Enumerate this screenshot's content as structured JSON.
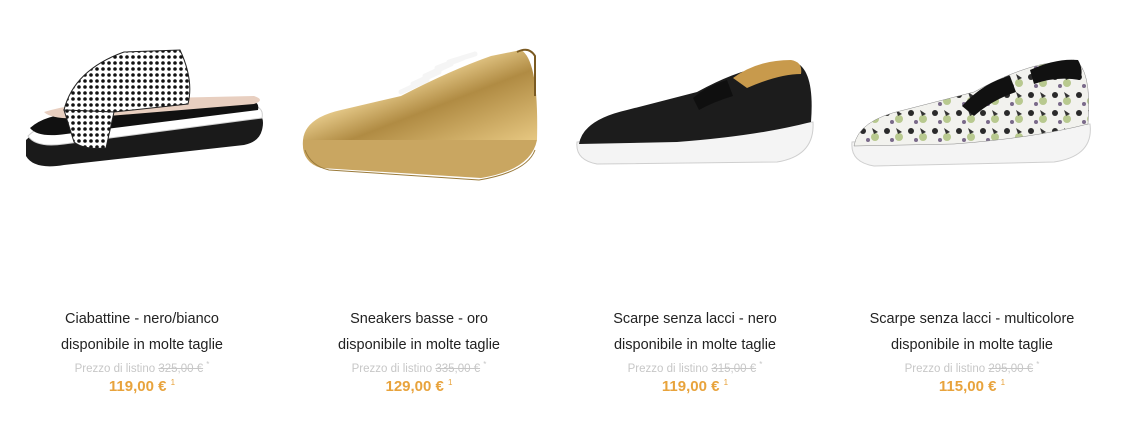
{
  "products": [
    {
      "name": "Ciabattine - nero/bianco",
      "availability": "disponibile in molte taglie",
      "list_label": "Prezzo di listino",
      "list_price": "325,00 €",
      "list_mark": "*",
      "price": "119,00 €",
      "price_mark": "1",
      "image_icon": "sandal-icon"
    },
    {
      "name": "Sneakers basse - oro",
      "availability": "disponibile in molte taglie",
      "list_label": "Prezzo di listino",
      "list_price": "335,00 €",
      "list_mark": "*",
      "price": "129,00 €",
      "price_mark": "1",
      "image_icon": "sneaker-icon"
    },
    {
      "name": "Scarpe senza lacci - nero",
      "availability": "disponibile in molte taglie",
      "list_label": "Prezzo di listino",
      "list_price": "315,00 €",
      "list_mark": "*",
      "price": "119,00 €",
      "price_mark": "1",
      "image_icon": "slip-on-icon"
    },
    {
      "name": "Scarpe senza lacci - multicolore",
      "availability": "disponibile in molte taglie",
      "list_label": "Prezzo di listino",
      "list_price": "295,00 €",
      "list_mark": "*",
      "price": "115,00 €",
      "price_mark": "1",
      "image_icon": "slip-on-icon"
    }
  ],
  "colors": {
    "price": "#e8a33c",
    "list_price": "#c7c7c7",
    "name": "#222222"
  }
}
